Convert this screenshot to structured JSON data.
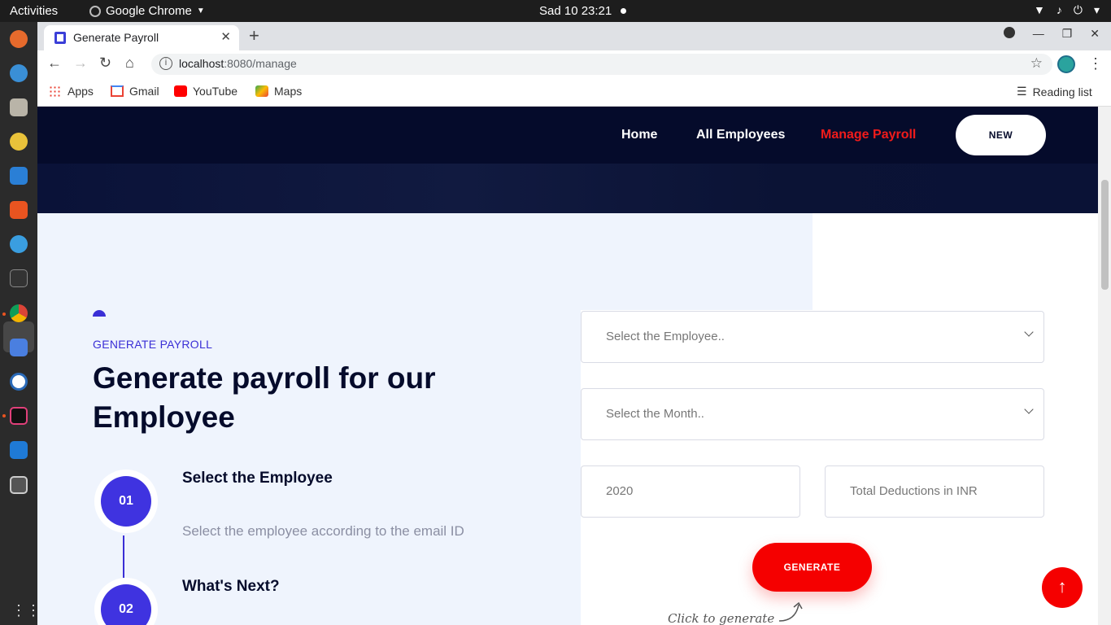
{
  "system_bar": {
    "activities": "Activities",
    "app_name": "Google Chrome",
    "clock": "Sad 10  23:21"
  },
  "browser": {
    "tab_title": "Generate Payroll",
    "url_host": "localhost",
    "url_rest": ":8080/manage",
    "bookmarks": [
      "Apps",
      "Gmail",
      "YouTube",
      "Maps"
    ],
    "reading_list": "Reading list"
  },
  "nav": {
    "links": [
      "Home",
      "All Employees",
      "Manage Payroll"
    ],
    "active": "Manage Payroll",
    "new_button": "NEW"
  },
  "section": {
    "subtitle": "GENERATE PAYROLL",
    "headline": "Generate payroll for our Employee",
    "steps": [
      {
        "number": "01",
        "title": "Select the Employee",
        "description": "Select the employee according to the email ID"
      },
      {
        "number": "02",
        "title": "What's Next?"
      }
    ]
  },
  "form": {
    "employee_placeholder": "Select the Employee..",
    "month_placeholder": "Select the Month..",
    "year_value": "2020",
    "deductions_placeholder": "Total Deductions in INR",
    "generate_button": "GENERATE",
    "hint": "Click to generate"
  },
  "colors": {
    "accent": "#3a2fd6",
    "danger": "#f50000",
    "navbar": "#050b2b",
    "panel": "#eff4fd"
  }
}
